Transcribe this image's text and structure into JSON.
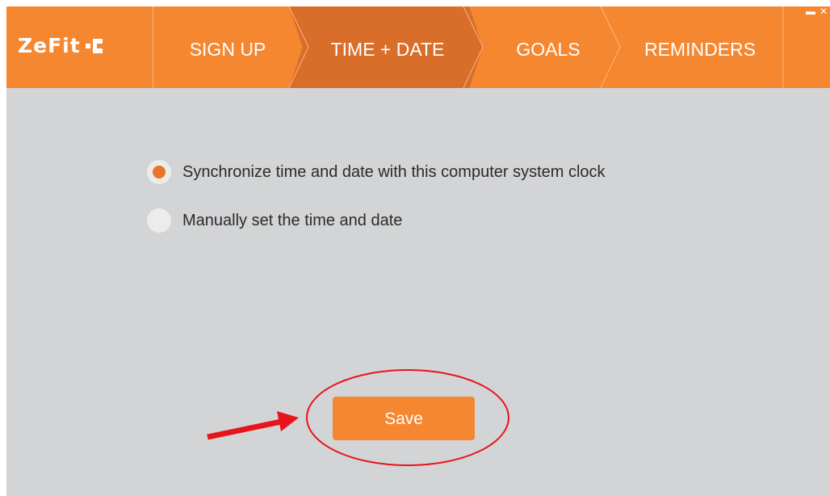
{
  "app": {
    "logo_text": "ZeFit",
    "brand_color": "#f58731",
    "active_tab_color": "#d86e2a"
  },
  "window_controls": {
    "minimize_glyph": "▬",
    "close_glyph": "✕"
  },
  "tabs": [
    {
      "label": "SIGN UP",
      "active": false
    },
    {
      "label": "TIME + DATE",
      "active": true
    },
    {
      "label": "GOALS",
      "active": false
    },
    {
      "label": "REMINDERS",
      "active": false
    }
  ],
  "options": [
    {
      "label": "Synchronize time and date with this computer system clock",
      "checked": true
    },
    {
      "label": "Manually set the time and date",
      "checked": false
    }
  ],
  "save_button": {
    "label": "Save"
  },
  "annotation": {
    "color": "#e8141b",
    "icons": [
      "red-arrow-icon",
      "red-ellipse-highlight"
    ]
  }
}
